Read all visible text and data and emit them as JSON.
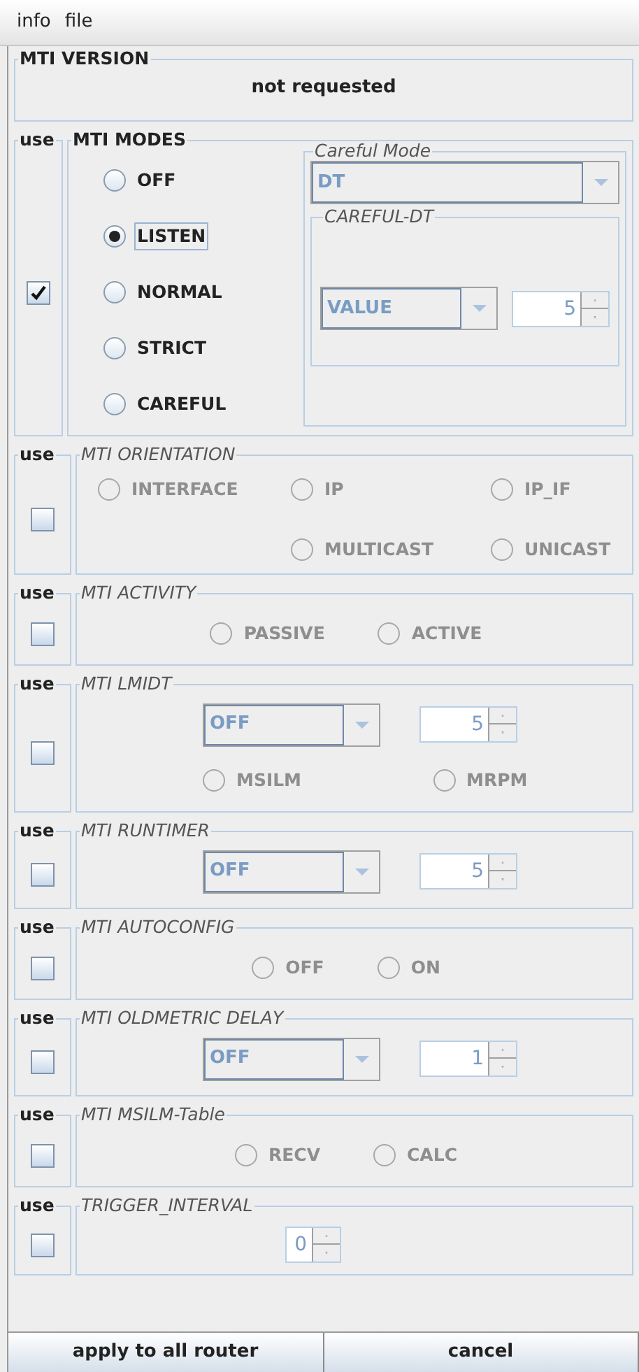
{
  "menu": [
    {
      "label": "info"
    },
    {
      "label": "file"
    }
  ],
  "version": {
    "title": "MTI VERSION",
    "value": "not requested"
  },
  "sections": [
    {
      "use": "use",
      "checked": true,
      "title": "MTI MODES",
      "disabled": false,
      "kind": "modes",
      "options": [
        {
          "label": "OFF",
          "selected": false,
          "focused": false
        },
        {
          "label": "LISTEN",
          "selected": true,
          "focused": true
        },
        {
          "label": "NORMAL",
          "selected": false,
          "focused": false
        },
        {
          "label": "STRICT",
          "selected": false,
          "focused": false
        },
        {
          "label": "CAREFUL",
          "selected": false,
          "focused": false
        }
      ],
      "careful": {
        "title": "Careful Mode",
        "combo": "DT",
        "disabled": true,
        "group": {
          "title": "CAREFUL-DT",
          "combo": "VALUE",
          "spinner": "5"
        }
      }
    },
    {
      "use": "use",
      "checked": false,
      "title": "MTI ORIENTATION",
      "disabled": true,
      "kind": "radio_grid",
      "rows": [
        [
          {
            "label": "INTERFACE",
            "selected": false
          },
          {
            "label": "IP",
            "selected": false
          },
          {
            "label": "IP_IF",
            "selected": false
          }
        ],
        [
          "",
          {
            "label": "MULTICAST",
            "selected": false
          },
          {
            "label": "UNICAST",
            "selected": false
          }
        ]
      ]
    },
    {
      "use": "use",
      "checked": false,
      "title": "MTI ACTIVITY",
      "disabled": true,
      "kind": "radios",
      "options": [
        {
          "label": "PASSIVE",
          "selected": false
        },
        {
          "label": "ACTIVE",
          "selected": false
        }
      ]
    },
    {
      "use": "use",
      "checked": false,
      "title": "MTI LMIDT",
      "disabled": true,
      "kind": "combo_spinner",
      "combo": "OFF",
      "spinner": "5",
      "options": [
        {
          "label": "MSILM",
          "selected": false
        },
        {
          "label": "MRPM",
          "selected": false
        }
      ]
    },
    {
      "use": "use",
      "checked": false,
      "title": "MTI RUNTIMER",
      "disabled": true,
      "kind": "combo_spinner",
      "combo": "OFF",
      "spinner": "5"
    },
    {
      "use": "use",
      "checked": false,
      "title": "MTI AUTOCONFIG",
      "disabled": true,
      "kind": "radios",
      "options": [
        {
          "label": "OFF",
          "selected": false
        },
        {
          "label": "ON",
          "selected": false
        }
      ]
    },
    {
      "use": "use",
      "checked": false,
      "title": "MTI OLDMETRIC DELAY",
      "disabled": true,
      "kind": "combo_spinner",
      "combo": "OFF",
      "spinner": "1"
    },
    {
      "use": "use",
      "checked": false,
      "title": "MTI MSILM-Table",
      "disabled": true,
      "kind": "radios",
      "options": [
        {
          "label": "RECV",
          "selected": false
        },
        {
          "label": "CALC",
          "selected": false
        }
      ]
    },
    {
      "use": "use",
      "checked": false,
      "title": "TRIGGER_INTERVAL",
      "disabled": true,
      "kind": "spinner",
      "spinner": "0"
    }
  ],
  "buttons": [
    {
      "label": "apply to all router"
    },
    {
      "label": "cancel"
    }
  ]
}
